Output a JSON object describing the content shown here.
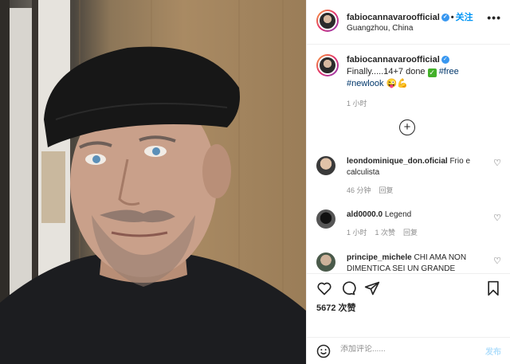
{
  "post": {
    "username": "fabiocannavaroofficial",
    "verified_icon": "verified-badge-icon",
    "follow_label": "关注",
    "separator": "•",
    "location": "Guangzhou, China",
    "more_label": "•••"
  },
  "caption": {
    "username": "fabiocannavaroofficial",
    "text_before": "Finally.....14+7 done ",
    "check_emoji": "✓",
    "hashtag1": "#free",
    "hashtag2": "#newlook",
    "emojis": "😜💪",
    "time": "1 小时"
  },
  "load_more_icon": "plus-circle-icon",
  "comments": [
    {
      "username": "leondominique_don.oficial",
      "text": "Frio e calculista",
      "time": "46 分钟",
      "reply": "回复"
    },
    {
      "username": "ald0000.0",
      "text": "Legend",
      "time": "1 小时",
      "likes": "1 次赞",
      "reply": "回复"
    },
    {
      "username": "principe_michele",
      "text": "CHI AMA NON DIMENTICA SEI UN GRANDE"
    }
  ],
  "likes_text": "5672 次赞",
  "add_comment": {
    "placeholder": "添加评论......",
    "post_label": "发布"
  },
  "colors": {
    "link_blue": "#0095f6",
    "hashtag": "#00376b",
    "muted": "#8e8e8e",
    "post_disabled": "#b2dffc"
  }
}
